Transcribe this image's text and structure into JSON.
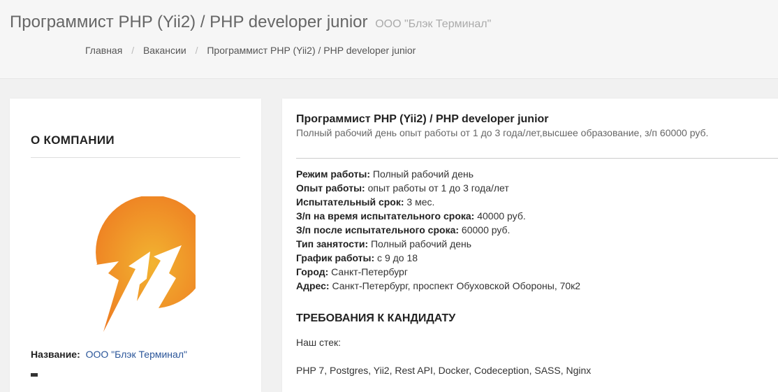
{
  "header": {
    "title": "Программист PHP (Yii2) / PHP developer junior",
    "company": "ООО \"Блэк Терминал\"",
    "breadcrumb": [
      {
        "label": "Главная"
      },
      {
        "label": "Вакансии"
      },
      {
        "label": "Программист PHP (Yii2) / PHP developer junior"
      }
    ],
    "breadcrumb_separator": "/"
  },
  "company_panel": {
    "heading": "О КОМПАНИИ",
    "logo_icon": "black-terminal-logo",
    "name_label": "Название:",
    "name_value": "ООО \"Блэк Терминал\""
  },
  "vacancy": {
    "title": "Программист PHP (Yii2) / PHP developer junior",
    "summary": "Полный рабочий день опыт работы от 1 до 3 года/лет,высшее образование, з/п 60000 руб.",
    "details": [
      {
        "label": "Режим работы:",
        "value": " Полный рабочий день"
      },
      {
        "label": "Опыт работы:",
        "value": " опыт работы от 1 до 3 года/лет"
      },
      {
        "label": "Испытательный срок:",
        "value": " 3 мес."
      },
      {
        "label": "З/п на время испытательного срока:",
        "value": " 40000 руб."
      },
      {
        "label": "З/п после испытательного срока:",
        "value": " 60000 руб."
      },
      {
        "label": "Тип занятости:",
        "value": " Полный рабочий день"
      },
      {
        "label": "График работы:",
        "value": " с 9 до 18"
      },
      {
        "label": "Город:",
        "value": " Санкт-Петербург"
      },
      {
        "label": "Адрес:",
        "value": " Санкт-Петербург, проспект Обуховской Обороны, 70к2"
      }
    ],
    "requirements_heading": "ТРЕБОВАНИЯ К КАНДИДАТУ",
    "requirements_intro": "Наш стек:",
    "requirements_stack": "PHP 7, Postgres, Yii2, Rest API, Docker, Codeception, SASS, Nginx"
  },
  "colors": {
    "logo_orange_light": "#f2b431",
    "logo_orange_dark": "#ee7d22",
    "link": "#2a5599"
  }
}
